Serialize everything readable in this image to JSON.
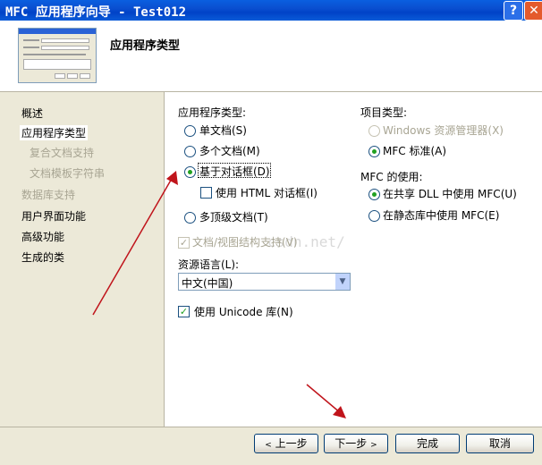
{
  "window": {
    "title": "MFC 应用程序向导 - Test012",
    "help_label": "?",
    "close_label": "✕"
  },
  "header": {
    "title": "应用程序类型"
  },
  "nav": {
    "items": [
      {
        "label": "概述"
      },
      {
        "label": "应用程序类型"
      },
      {
        "label": "复合文档支持"
      },
      {
        "label": "文档模板字符串"
      },
      {
        "label": "数据库支持"
      },
      {
        "label": "用户界面功能"
      },
      {
        "label": "高级功能"
      },
      {
        "label": "生成的类"
      }
    ]
  },
  "app_type": {
    "label": "应用程序类型:",
    "options": [
      {
        "label": "单文档(S)",
        "selected": false
      },
      {
        "label": "多个文档(M)",
        "selected": false
      },
      {
        "label": "基于对话框(D)",
        "selected": true
      },
      {
        "label": "多顶级文档(T)",
        "selected": false
      }
    ],
    "html_dialog_label": "使用 HTML 对话框(I)",
    "doc_view_label": "文档/视图结构支持(V)"
  },
  "project_type": {
    "label": "项目类型:",
    "options": [
      {
        "label": "Windows 资源管理器(X)",
        "selected": false,
        "disabled": true
      },
      {
        "label": "MFC 标准(A)",
        "selected": true,
        "disabled": false
      }
    ]
  },
  "mfc_use": {
    "label": "MFC 的使用:",
    "options": [
      {
        "label": "在共享 DLL 中使用 MFC(U)",
        "selected": true
      },
      {
        "label": "在静态库中使用 MFC(E)",
        "selected": false
      }
    ]
  },
  "resource_language": {
    "label": "资源语言(L):",
    "value": "中文(中国)"
  },
  "unicode": {
    "label": "使用 Unicode 库(N)",
    "checked": true
  },
  "watermark": "csdn.net/",
  "buttons": {
    "prev": "上一步",
    "next": "下一步",
    "finish": "完成",
    "cancel": "取消"
  },
  "colors": {
    "titlebar": "#0a4fd0",
    "arrow": "#c0141b",
    "radio_dot": "#21a121"
  }
}
